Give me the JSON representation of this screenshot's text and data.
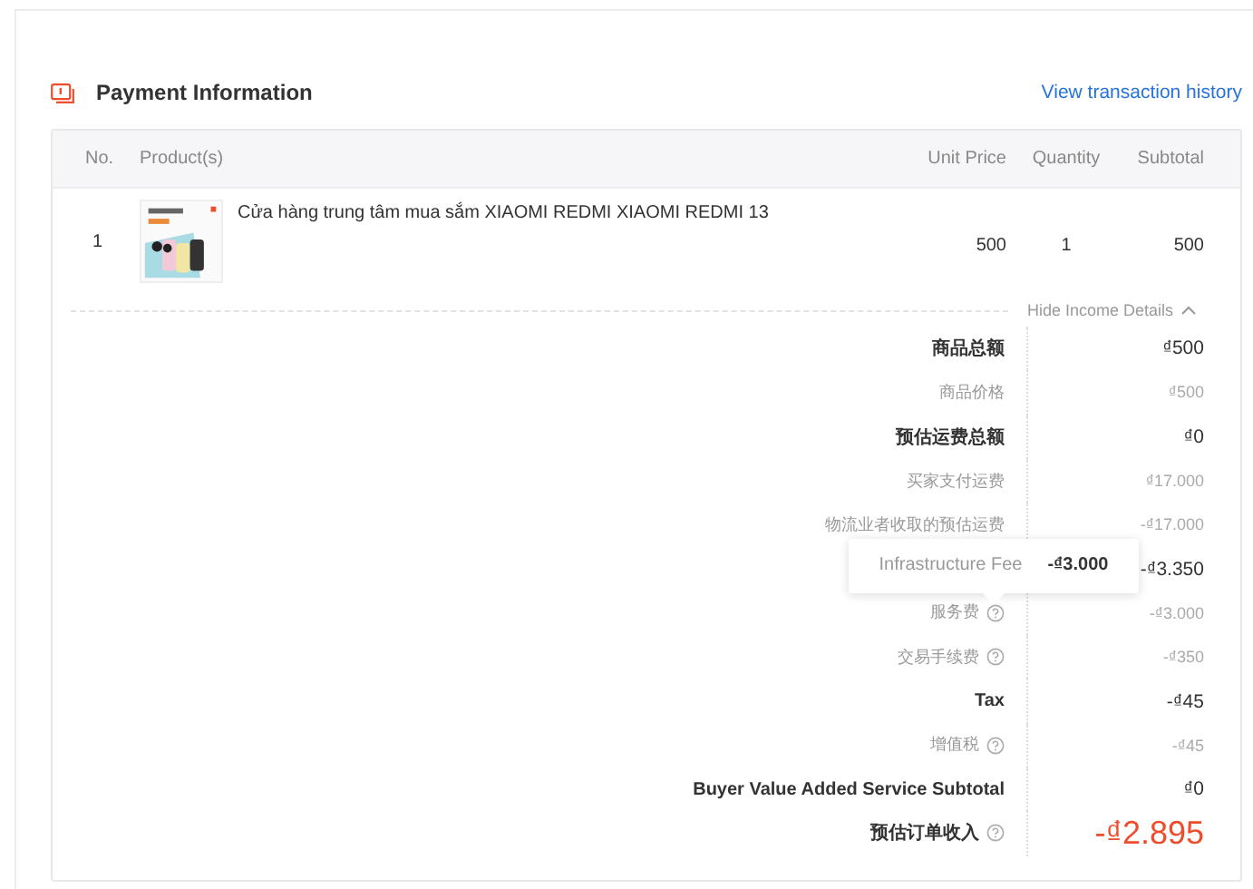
{
  "section": {
    "title": "Payment Information",
    "link": "View transaction history"
  },
  "table": {
    "columns": [
      "No.",
      "Product(s)",
      "Unit Price",
      "Quantity",
      "Subtotal"
    ],
    "rows": [
      {
        "no": "1",
        "product": "Cửa hàng trung tâm mua sắm XIAOMI REDMI XIAOMI REDMI 13",
        "unit_price": "500",
        "quantity": "1",
        "subtotal": "500"
      }
    ]
  },
  "income_details": {
    "toggle": "Hide Income Details",
    "expanded": true,
    "rows": [
      {
        "kind": "group",
        "label": "商品总额",
        "value": "₫500"
      },
      {
        "kind": "item",
        "label": "商品价格",
        "value": "₫500"
      },
      {
        "kind": "group",
        "label": "预估运费总额",
        "value": "₫0"
      },
      {
        "kind": "item",
        "label": "买家支付运费",
        "value": "₫17.000"
      },
      {
        "kind": "item",
        "label": "物流业者收取的预估运费",
        "value": "-₫17.000"
      },
      {
        "kind": "group",
        "value": "-₫3.350"
      },
      {
        "kind": "item",
        "label": "服务费",
        "help": true,
        "value": "-₫3.000",
        "tooltip": {
          "label": "Infrastructure Fee",
          "value": "-₫3.000"
        }
      },
      {
        "kind": "item",
        "label": "交易手续费",
        "help": true,
        "value": "-₫350"
      },
      {
        "kind": "group",
        "label": "Tax",
        "value": "-₫45"
      },
      {
        "kind": "item",
        "label": "增值税",
        "help": true,
        "value": "-₫45"
      },
      {
        "kind": "group",
        "label": "Buyer Value Added Service Subtotal",
        "value": "₫0"
      },
      {
        "kind": "total",
        "label": "预估订单收入",
        "help": true,
        "value": "-₫2.895"
      }
    ]
  }
}
